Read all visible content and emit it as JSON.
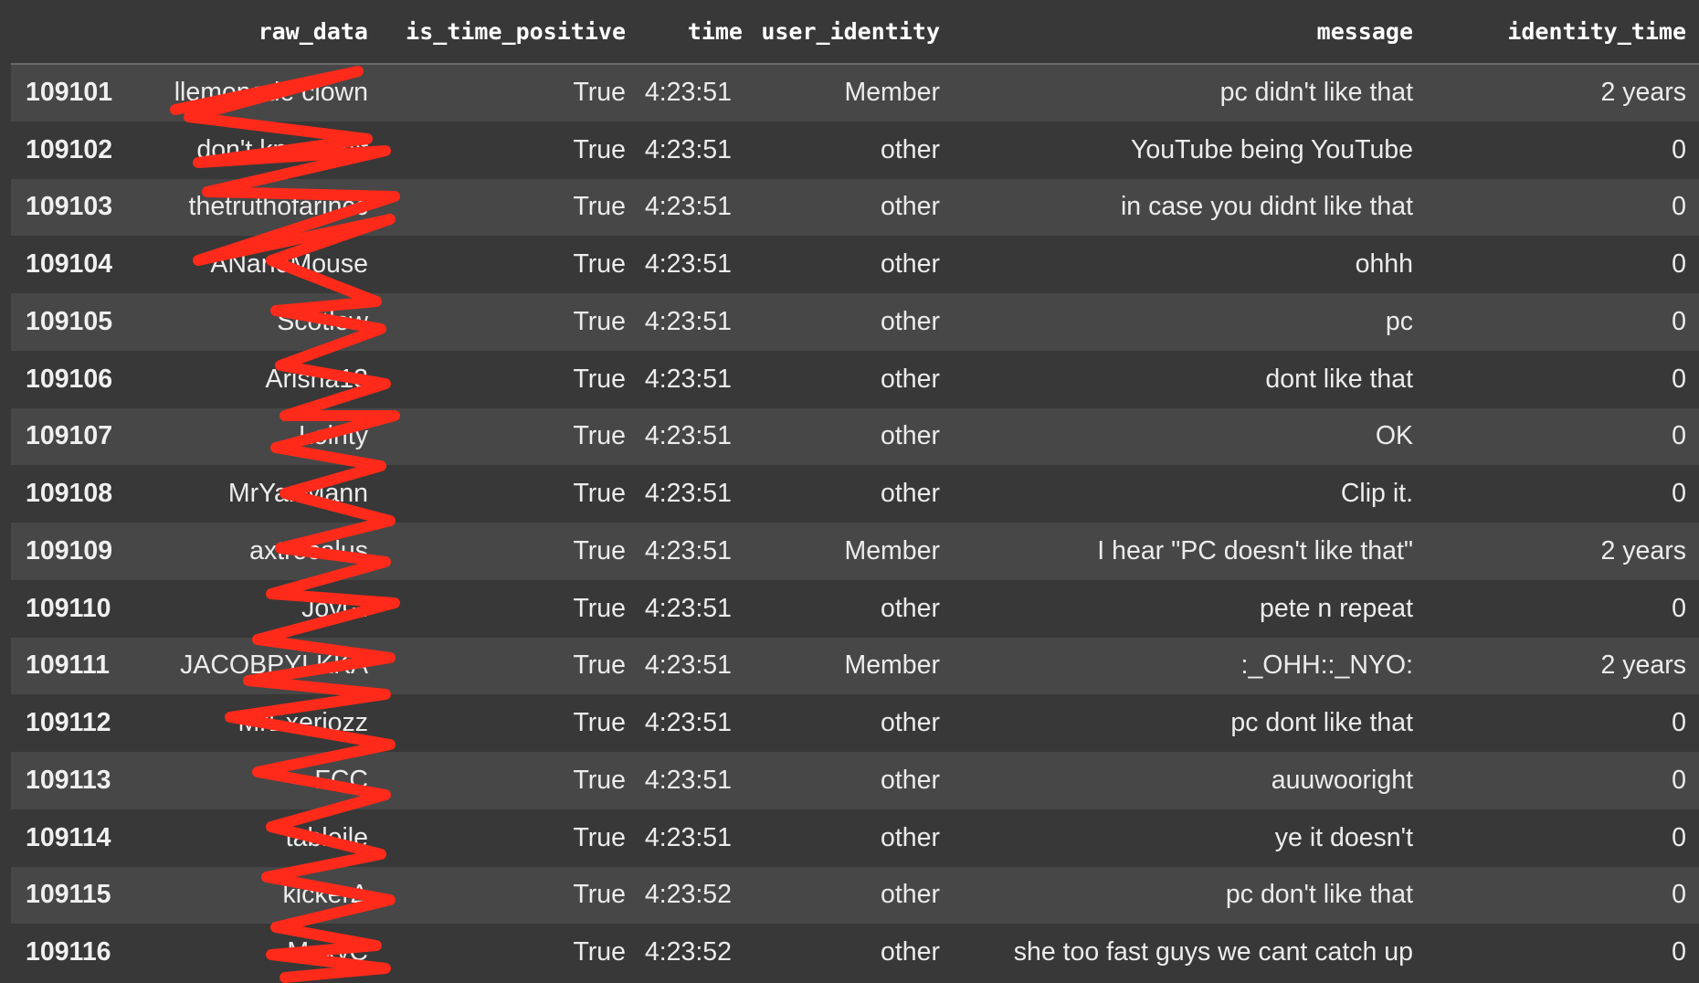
{
  "columns": [
    "",
    "raw_data",
    "is_time_positive",
    "time",
    "user_identity",
    "message",
    "identity_time"
  ],
  "rows": [
    {
      "index": "109101",
      "raw_data": "llemonade clown",
      "is_time_positive": "True",
      "time": "4:23:51",
      "user_identity": "Member",
      "message": "pc didn't like that",
      "identity_time": "2 years"
    },
    {
      "index": "109102",
      "raw_data": "don't know shit",
      "is_time_positive": "True",
      "time": "4:23:51",
      "user_identity": "other",
      "message": "YouTube being YouTube",
      "identity_time": "0"
    },
    {
      "index": "109103",
      "raw_data": "thetruthofarincc",
      "is_time_positive": "True",
      "time": "4:23:51",
      "user_identity": "other",
      "message": "in case you didnt like that",
      "identity_time": "0"
    },
    {
      "index": "109104",
      "raw_data": "ANanoMouse",
      "is_time_positive": "True",
      "time": "4:23:51",
      "user_identity": "other",
      "message": "ohhh",
      "identity_time": "0"
    },
    {
      "index": "109105",
      "raw_data": "Scotlow",
      "is_time_positive": "True",
      "time": "4:23:51",
      "user_identity": "other",
      "message": "pc",
      "identity_time": "0"
    },
    {
      "index": "109106",
      "raw_data": "Arisha13",
      "is_time_positive": "True",
      "time": "4:23:51",
      "user_identity": "other",
      "message": "dont like that",
      "identity_time": "0"
    },
    {
      "index": "109107",
      "raw_data": "Lolrity",
      "is_time_positive": "True",
      "time": "4:23:51",
      "user_identity": "other",
      "message": "OK",
      "identity_time": "0"
    },
    {
      "index": "109108",
      "raw_data": "MrYanMann",
      "is_time_positive": "True",
      "time": "4:23:51",
      "user_identity": "other",
      "message": "Clip it.",
      "identity_time": "0"
    },
    {
      "index": "109109",
      "raw_data": "axtrocalus",
      "is_time_positive": "True",
      "time": "4:23:51",
      "user_identity": "Member",
      "message": "I hear \"PC doesn't like that\"",
      "identity_time": "2 years"
    },
    {
      "index": "109110",
      "raw_data": "JoyGi",
      "is_time_positive": "True",
      "time": "4:23:51",
      "user_identity": "other",
      "message": "pete n repeat",
      "identity_time": "0"
    },
    {
      "index": "109111",
      "raw_data": "JACOBPYLKKA",
      "is_time_positive": "True",
      "time": "4:23:51",
      "user_identity": "Member",
      "message": ":_OHH::_NYO:",
      "identity_time": "2 years"
    },
    {
      "index": "109112",
      "raw_data": "MrExeriozz",
      "is_time_positive": "True",
      "time": "4:23:51",
      "user_identity": "other",
      "message": "pc dont like that",
      "identity_time": "0"
    },
    {
      "index": "109113",
      "raw_data": "FCC",
      "is_time_positive": "True",
      "time": "4:23:51",
      "user_identity": "other",
      "message": "auuwooright",
      "identity_time": "0"
    },
    {
      "index": "109114",
      "raw_data": "tableile",
      "is_time_positive": "True",
      "time": "4:23:51",
      "user_identity": "other",
      "message": "ye it doesn't",
      "identity_time": "0"
    },
    {
      "index": "109115",
      "raw_data": "kickerΔ",
      "is_time_positive": "True",
      "time": "4:23:52",
      "user_identity": "other",
      "message": "pc don't like that",
      "identity_time": "0"
    },
    {
      "index": "109116",
      "raw_data": "MaxyC",
      "is_time_positive": "True",
      "time": "4:23:52",
      "user_identity": "other",
      "message": "she too fast guys we cant catch up",
      "identity_time": "0"
    }
  ],
  "colors": {
    "background": "#383838",
    "row_stripe": "#474747",
    "redaction": "#ff2a1a"
  }
}
